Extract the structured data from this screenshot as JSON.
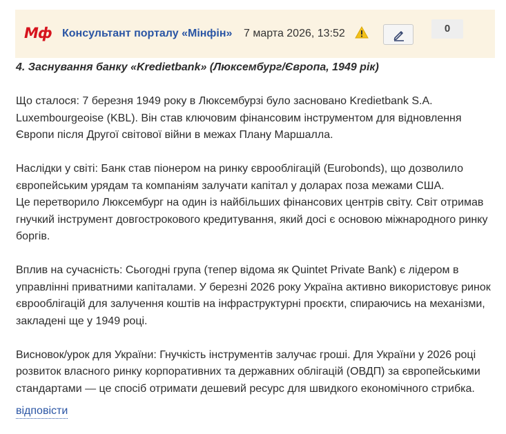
{
  "colors": {
    "header_bg": "#fbf3e2",
    "logo_red": "#d6141e",
    "link_blue": "#2a55a4",
    "warning_yellow": "#f3c019"
  },
  "header": {
    "logo_text": "Мф",
    "author": "Консультант порталу «Мінфін»",
    "date": "7 марта 2026, 13:52",
    "warning_icon": "warning-triangle-icon",
    "edit_icon": "pencil-icon",
    "counter": "0"
  },
  "post": {
    "heading": "4. Заснування банку «Kredietbank» (Люксембург/Європа, 1949 рік)",
    "p1": "Що сталося: 7 березня 1949 року в Люксембурзі було засновано Kredietbank S.A. Luxembourgeoise (KBL). Він став ключовим фінансовим інструментом для відновлення Європи після Другої світової війни в межах Плану Маршалла.",
    "p2a": "Наслідки у світі: Банк став піонером на ринку єврооблігацій (Eurobonds), що дозволило європейським урядам та компаніям залучати капітал у доларах поза межами США.",
    "p2b": "Це перетворило Люксембург на один із найбільших фінансових центрів світу. Світ отримав гнучкий інструмент довгострокового кредитування, який досі є основою міжнародного ринку боргів.",
    "p3": "Вплив на сучасність: Сьогодні група (тепер відома як Quintet Private Bank) є лідером в управлінні приватними капіталами. У березні 2026 року Україна активно використовує ринок єврооблігацій для залучення коштів на інфраструктурні проєкти, спираючись на механізми, закладені ще у 1949 році.",
    "p4": "Висновок/урок для України: Гнучкість інструментів залучає гроші. Для України у 2026 році розвиток власного ринку корпоративних та державних облігацій (ОВДП) за європейськими стандартами — це спосіб отримати дешевий ресурс для швидкого економічного стрибка."
  },
  "actions": {
    "reply": "відповісти"
  }
}
